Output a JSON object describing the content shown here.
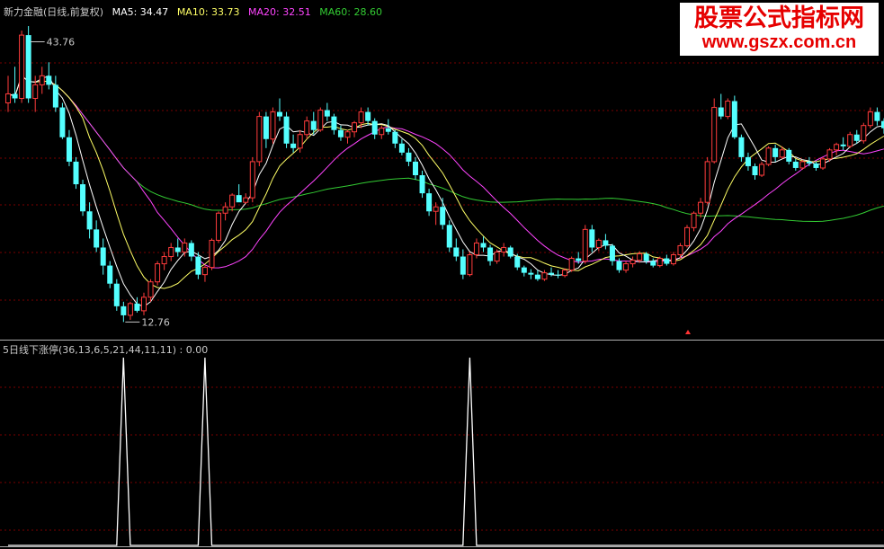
{
  "legend": {
    "title": "新力金融(日线,前复权)",
    "ma5": "MA5: 34.47",
    "ma10": "MA10: 33.73",
    "ma20": "MA20: 32.51",
    "ma60": "MA60: 28.60"
  },
  "indicator": {
    "label": "5日线下涨停(36,13,6,5,21,44,11,11)  : 0.00"
  },
  "watermark": {
    "title": "股票公式指标网",
    "url": "www.gszx.com.cn"
  },
  "colors": {
    "up": "#ff3c3c",
    "down": "#54ffff",
    "ma5": "#ffffff",
    "ma10": "#ffff66",
    "ma20": "#ff44ff",
    "ma60": "#33cc33",
    "grid": "#7a0000",
    "indicator": "#ffffff"
  },
  "chart_data": [
    {
      "type": "candlestick",
      "title": "新力金融(日线,前复权)",
      "ylim": [
        12,
        46
      ],
      "annotations": [
        {
          "text": "43.76",
          "y": 43.76
        },
        {
          "text": "12.76",
          "y": 12.76
        }
      ],
      "candles": [
        [
          37,
          40,
          36,
          38
        ],
        [
          38,
          41,
          37,
          37.5
        ],
        [
          37.5,
          45,
          37,
          44.5
        ],
        [
          44.5,
          45.5,
          37,
          37.5
        ],
        [
          37.5,
          40,
          36,
          39
        ],
        [
          39,
          41,
          38,
          40
        ],
        [
          40,
          41.5,
          38.5,
          39
        ],
        [
          39,
          40,
          36,
          36.5
        ],
        [
          36.5,
          37,
          33,
          33.2
        ],
        [
          33.2,
          34,
          30,
          30.5
        ],
        [
          30.5,
          31,
          27.5,
          28
        ],
        [
          28,
          28.5,
          24.5,
          25
        ],
        [
          25,
          26,
          22,
          23
        ],
        [
          23,
          24,
          20.5,
          21
        ],
        [
          21,
          22,
          18,
          19
        ],
        [
          19,
          19.5,
          16.5,
          17
        ],
        [
          17,
          17.5,
          14,
          14.5
        ],
        [
          14.5,
          15,
          12.76,
          13.5
        ],
        [
          13.5,
          15,
          13,
          14.8
        ],
        [
          14.8,
          15.5,
          13.8,
          14
        ],
        [
          14,
          16,
          13.5,
          15.5
        ],
        [
          15.5,
          17.5,
          15,
          17.2
        ],
        [
          17.2,
          19.5,
          16.8,
          19.2
        ],
        [
          19.2,
          20.5,
          18.5,
          20
        ],
        [
          20,
          21.5,
          19.5,
          21
        ],
        [
          21,
          22,
          20,
          20.5
        ],
        [
          20.5,
          22,
          20,
          21.5
        ],
        [
          21.5,
          21.8,
          19.5,
          20
        ],
        [
          20,
          20.5,
          17.5,
          18
        ],
        [
          18,
          19,
          17.2,
          18.8
        ],
        [
          18.8,
          22,
          18.5,
          21.8
        ],
        [
          21.8,
          25,
          21.5,
          24.8
        ],
        [
          24.8,
          26,
          24,
          25.5
        ],
        [
          25.5,
          27,
          25,
          26.8
        ],
        [
          26.8,
          28,
          26.5,
          26
        ],
        [
          26,
          27,
          25.8,
          26.5
        ],
        [
          26.5,
          31,
          26,
          30.5
        ],
        [
          30.5,
          36,
          30,
          35.5
        ],
        [
          35.5,
          36,
          32,
          33
        ],
        [
          33,
          36.5,
          32.5,
          36
        ],
        [
          36,
          37.5,
          35,
          35.5
        ],
        [
          35.5,
          36,
          32,
          32.5
        ],
        [
          32.5,
          33.5,
          31.5,
          32
        ],
        [
          32,
          34,
          31.5,
          33.5
        ],
        [
          33.5,
          35.5,
          33,
          35
        ],
        [
          35,
          36,
          33.5,
          34
        ],
        [
          34,
          36.5,
          33.8,
          36.2
        ],
        [
          36.2,
          37,
          35,
          35.5
        ],
        [
          35.5,
          35.8,
          33.5,
          34
        ],
        [
          34,
          34.5,
          32.8,
          33.2
        ],
        [
          33.2,
          34,
          32.5,
          33.8
        ],
        [
          33.8,
          35,
          33.2,
          34.8
        ],
        [
          34.8,
          36.5,
          34.2,
          36
        ],
        [
          36,
          36.5,
          34.5,
          35
        ],
        [
          35,
          35.3,
          33,
          33.5
        ],
        [
          33.5,
          34.5,
          33,
          34.2
        ],
        [
          34.2,
          35.2,
          33.5,
          33.8
        ],
        [
          33.8,
          34,
          32,
          32.5
        ],
        [
          32.5,
          33,
          31.2,
          31.5
        ],
        [
          31.5,
          32,
          30,
          30.5
        ],
        [
          30.5,
          31,
          28.5,
          29
        ],
        [
          29,
          29.5,
          26.5,
          27
        ],
        [
          27,
          27.5,
          24.5,
          25
        ],
        [
          25,
          26,
          23.5,
          25.5
        ],
        [
          25.5,
          26.5,
          23,
          23.5
        ],
        [
          23.5,
          24,
          20.5,
          21
        ],
        [
          21,
          22,
          19.5,
          20
        ],
        [
          20,
          20.8,
          17.5,
          18
        ],
        [
          18,
          20.5,
          17.8,
          20.2
        ],
        [
          20.2,
          22,
          19.8,
          21.5
        ],
        [
          21.5,
          22.2,
          20.5,
          21
        ],
        [
          21,
          21.3,
          19,
          19.5
        ],
        [
          19.5,
          20.8,
          19.2,
          20.5
        ],
        [
          20.5,
          21.5,
          20,
          21
        ],
        [
          21,
          21.2,
          19.8,
          20
        ],
        [
          20,
          20.3,
          18.5,
          18.8
        ],
        [
          18.8,
          19,
          17.8,
          18.2
        ],
        [
          18.2,
          18.6,
          17.5,
          18
        ],
        [
          18,
          18.5,
          17.3,
          17.5
        ],
        [
          17.5,
          18.5,
          17.3,
          18.2
        ],
        [
          18.2,
          18.8,
          17.8,
          18
        ],
        [
          18,
          18.5,
          17.6,
          17.9
        ],
        [
          17.9,
          18.7,
          17.7,
          18.5
        ],
        [
          18.5,
          20,
          18.3,
          19.8
        ],
        [
          19.8,
          20.5,
          19.2,
          19.5
        ],
        [
          19.5,
          23.5,
          19.2,
          23
        ],
        [
          23,
          23.5,
          20.5,
          21
        ],
        [
          21,
          22,
          20.6,
          21.8
        ],
        [
          21.8,
          22.5,
          20.8,
          21.2
        ],
        [
          21.2,
          21.4,
          19,
          19.5
        ],
        [
          19.5,
          19.8,
          18.2,
          18.5
        ],
        [
          18.5,
          19.5,
          18.2,
          19.2
        ],
        [
          19.2,
          20,
          18.8,
          19.6
        ],
        [
          19.6,
          20.6,
          19.3,
          20.3
        ],
        [
          20.3,
          20.5,
          19.2,
          19.5
        ],
        [
          19.5,
          19.8,
          18.8,
          19
        ],
        [
          19,
          20,
          18.8,
          19.8
        ],
        [
          19.8,
          20.2,
          19,
          19.2
        ],
        [
          19.2,
          20.5,
          19,
          20.2
        ],
        [
          20.2,
          21.5,
          19.8,
          21.2
        ],
        [
          21.2,
          23.5,
          21,
          23.2
        ],
        [
          23.2,
          25,
          22.8,
          24.8
        ],
        [
          24.8,
          26.5,
          24.3,
          26
        ],
        [
          26,
          31,
          25.8,
          30.5
        ],
        [
          30.5,
          37.5,
          30.3,
          36.5
        ],
        [
          36.5,
          38,
          35.2,
          35.5
        ],
        [
          35.5,
          37.5,
          35.2,
          37.2
        ],
        [
          37.2,
          37.8,
          33,
          33.2
        ],
        [
          33.2,
          33.5,
          30.5,
          31
        ],
        [
          31,
          31.5,
          29.5,
          30
        ],
        [
          30,
          30.3,
          28.5,
          29
        ],
        [
          29,
          30.5,
          28.8,
          30.2
        ],
        [
          30.2,
          32.2,
          30,
          32
        ],
        [
          32,
          32.4,
          30.5,
          31
        ],
        [
          31,
          32.2,
          30.8,
          31.8
        ],
        [
          31.8,
          32,
          30.2,
          30.5
        ],
        [
          30.5,
          30.8,
          29.5,
          29.8
        ],
        [
          29.8,
          30.7,
          29.6,
          30.5
        ],
        [
          30.5,
          31,
          30,
          30.3
        ],
        [
          30.3,
          30.5,
          29.5,
          29.8
        ],
        [
          29.8,
          31,
          29.6,
          30.8
        ],
        [
          30.8,
          32,
          30.5,
          31.8
        ],
        [
          31.8,
          32.6,
          31.2,
          32.4
        ],
        [
          32.4,
          33.2,
          31.8,
          32.2
        ],
        [
          32.2,
          33.8,
          32,
          33.5
        ],
        [
          33.5,
          34,
          32.5,
          32.8
        ],
        [
          32.8,
          34.8,
          32.5,
          34.5
        ],
        [
          34.5,
          36.5,
          34.2,
          36
        ],
        [
          36,
          36.5,
          34.5,
          35
        ],
        [
          35,
          35.3,
          33.6,
          34.2
        ]
      ],
      "series": [
        {
          "name": "MA5",
          "value": 34.47
        },
        {
          "name": "MA10",
          "value": 33.73
        },
        {
          "name": "MA20",
          "value": 32.51
        },
        {
          "name": "MA60",
          "value": 28.6
        }
      ]
    },
    {
      "type": "line",
      "title": "5日线下涨停(36,13,6,5,21,44,11,11)",
      "ylim": [
        0,
        1
      ],
      "values": [
        0,
        0,
        0,
        0,
        0,
        0,
        0,
        0,
        0,
        0,
        0,
        0,
        0,
        0,
        0,
        0,
        0,
        0,
        0,
        0,
        0,
        0,
        0,
        0,
        0,
        0,
        0,
        0,
        0,
        0,
        0,
        0,
        0,
        0,
        0,
        0,
        0,
        0,
        0,
        0,
        0,
        0,
        0,
        0,
        0,
        0,
        0,
        0,
        0,
        0,
        0,
        0,
        0,
        0,
        0,
        0,
        0,
        0,
        0,
        0,
        0,
        0,
        0,
        0,
        0,
        0,
        0,
        0,
        0,
        0,
        0,
        0,
        0,
        0,
        0,
        0,
        0,
        0,
        0,
        0,
        0,
        0,
        0,
        0,
        0,
        0,
        0,
        0,
        0,
        0,
        0,
        0,
        0,
        0,
        0,
        0,
        0,
        0,
        0,
        0,
        0,
        0,
        0,
        0,
        0,
        0,
        0,
        0,
        0,
        0,
        0,
        0,
        0,
        0,
        0,
        0,
        0,
        0,
        0,
        0,
        0,
        0,
        0,
        0,
        0,
        0,
        0,
        0,
        0,
        0,
        0,
        0,
        0,
        0,
        0,
        0,
        0,
        0,
        0,
        0,
        0,
        0,
        0,
        0,
        0,
        0,
        0,
        0,
        0,
        0,
        0,
        0,
        0,
        0,
        0,
        0,
        0,
        0,
        0,
        0,
        0,
        0,
        0
      ],
      "spikes": [
        17,
        29,
        68
      ]
    }
  ]
}
